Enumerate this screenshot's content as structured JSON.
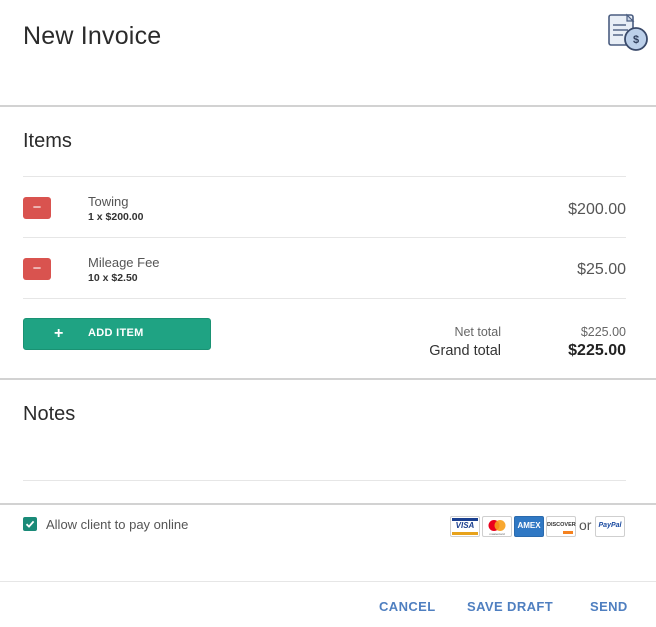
{
  "header": {
    "title": "New Invoice",
    "icon": "invoice-dollar-icon"
  },
  "items_section": {
    "title": "Items",
    "items": [
      {
        "name": "Towing",
        "qty": "1 x $200.00",
        "amount": "$200.00"
      },
      {
        "name": "Mileage Fee",
        "qty": "10 x $2.50",
        "amount": "$25.00"
      }
    ],
    "remove_label": "−",
    "add_item_plus": "+",
    "add_item_label": "ADD ITEM"
  },
  "totals": {
    "net_label": "Net total",
    "net_value": "$225.00",
    "grand_label": "Grand total",
    "grand_value": "$225.00"
  },
  "notes": {
    "title": "Notes",
    "value": ""
  },
  "payment": {
    "allow_online_label": "Allow client to pay online",
    "allow_online_checked": true,
    "cards": [
      "VISA",
      "mastercard",
      "AMEX",
      "DISCOVER",
      "PayPal"
    ],
    "or_label": "or"
  },
  "footer": {
    "cancel": "CANCEL",
    "save_draft": "SAVE DRAFT",
    "send": "SEND"
  },
  "colors": {
    "accent": "#1fa383",
    "danger": "#d9534f",
    "link": "#4f7fc0"
  }
}
